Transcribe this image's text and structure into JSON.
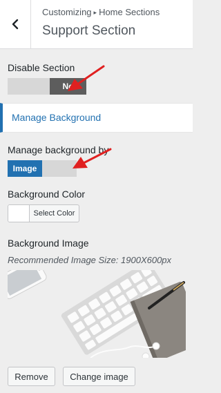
{
  "header": {
    "breadcrumb_root": "Customizing",
    "breadcrumb_sep": "▸",
    "breadcrumb_leaf": "Home Sections",
    "title": "Support Section"
  },
  "disable_section": {
    "label": "Disable Section",
    "toggle_value": "No"
  },
  "manage_background_link": "Manage Background",
  "manage_by": {
    "label": "Manage background by",
    "toggle_value": "Image"
  },
  "background_color": {
    "label": "Background Color",
    "button_label": "Select Color",
    "swatch_color": "#ffffff"
  },
  "background_image": {
    "label": "Background Image",
    "hint": "Recommended Image Size: 1900X600px"
  },
  "buttons": {
    "remove": "Remove",
    "change": "Change image"
  },
  "colors": {
    "accent": "#2271b1",
    "annotation_arrow": "#e02020"
  }
}
